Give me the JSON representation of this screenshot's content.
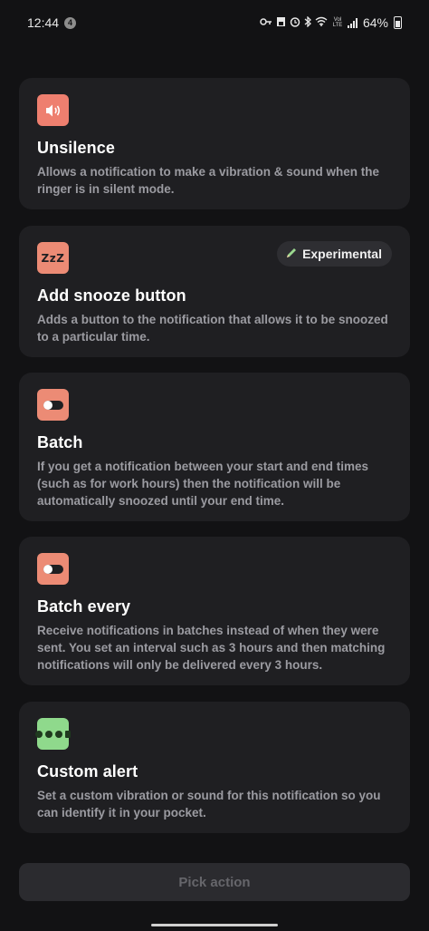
{
  "status_bar": {
    "time": "12:44",
    "notification_count": "4",
    "battery_percent": "64%",
    "network_label": "Vol LTE"
  },
  "cards": [
    {
      "title": "Unsilence",
      "description": "Allows a notification to make a vibration & sound when the ringer is in silent mode.",
      "icon": "speaker-icon",
      "icon_color": "#ee7f6f"
    },
    {
      "title": "Add snooze button",
      "description": "Adds a button to the notification that allows it to be snoozed to a particular time.",
      "icon": "zzz-icon",
      "icon_text": "ZzZ",
      "icon_color": "#ec8b75",
      "badge": "Experimental",
      "badge_icon": "pencil-icon"
    },
    {
      "title": "Batch",
      "description": "If you get a notification between your start and end times (such as for work hours) then the notification will be automatically snoozed until your end time.",
      "icon": "toggle-icon",
      "icon_color": "#ec8b75"
    },
    {
      "title": "Batch every",
      "description": "Receive notifications in batches instead of when they were sent. You set an interval such as 3 hours and then matching notifications will only be delivered every 3 hours.",
      "icon": "toggle-icon",
      "icon_color": "#ec8b75"
    },
    {
      "title": "Custom alert",
      "description": "Set a custom vibration or sound for this notification so you can identify it in your pocket.",
      "icon": "dots-icon",
      "icon_color": "#8fd98c"
    }
  ],
  "footer": {
    "pick_action_label": "Pick action"
  }
}
